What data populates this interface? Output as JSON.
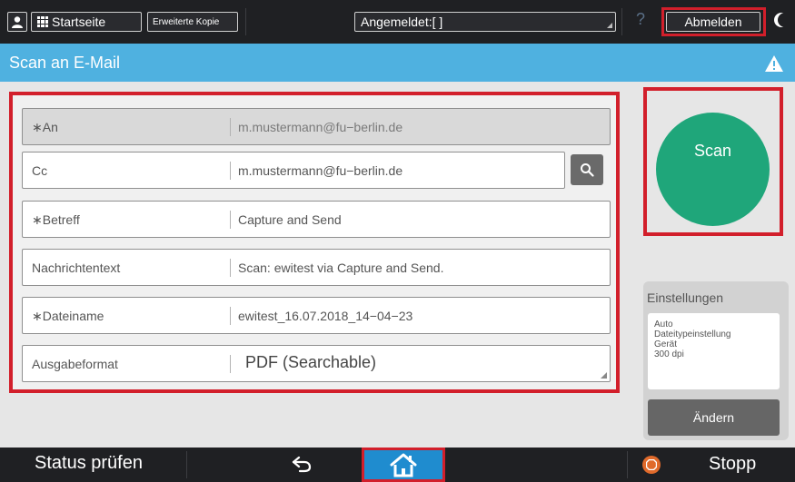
{
  "topbar": {
    "home_label": "Startseite",
    "copy_label": "Erweiterte Kopie",
    "login_label": "Angemeldet:[ ]",
    "help_glyph": "?",
    "logout_label": "Abmelden"
  },
  "titlebar": {
    "title": "Scan an E-Mail"
  },
  "form": {
    "rows": [
      {
        "label": "∗An",
        "value": "m.mustermann@fu−berlin.de"
      },
      {
        "label": "Cc",
        "value": "m.mustermann@fu−berlin.de"
      },
      {
        "label": "∗Betreff",
        "value": "Capture and Send"
      },
      {
        "label": "Nachrichtentext",
        "value": "Scan: ewitest via Capture and Send."
      },
      {
        "label": "∗Dateiname",
        "value": "ewitest_16.07.2018_14−04−23"
      },
      {
        "label": "Ausgabeformat",
        "value": "PDF (Searchable)"
      }
    ]
  },
  "scan": {
    "label": "Scan"
  },
  "settings": {
    "title": "Einstellungen",
    "lines": [
      "Auto",
      "Dateitypeinstellung",
      "Gerät",
      "300 dpi"
    ],
    "change_label": "Ändern"
  },
  "bottombar": {
    "status_label": "Status prüfen",
    "stop_label": "Stopp"
  },
  "colors": {
    "accent": "#4fb1e0",
    "scan": "#1fa67a",
    "highlight": "#d21f2b",
    "bar": "#1f2023"
  }
}
